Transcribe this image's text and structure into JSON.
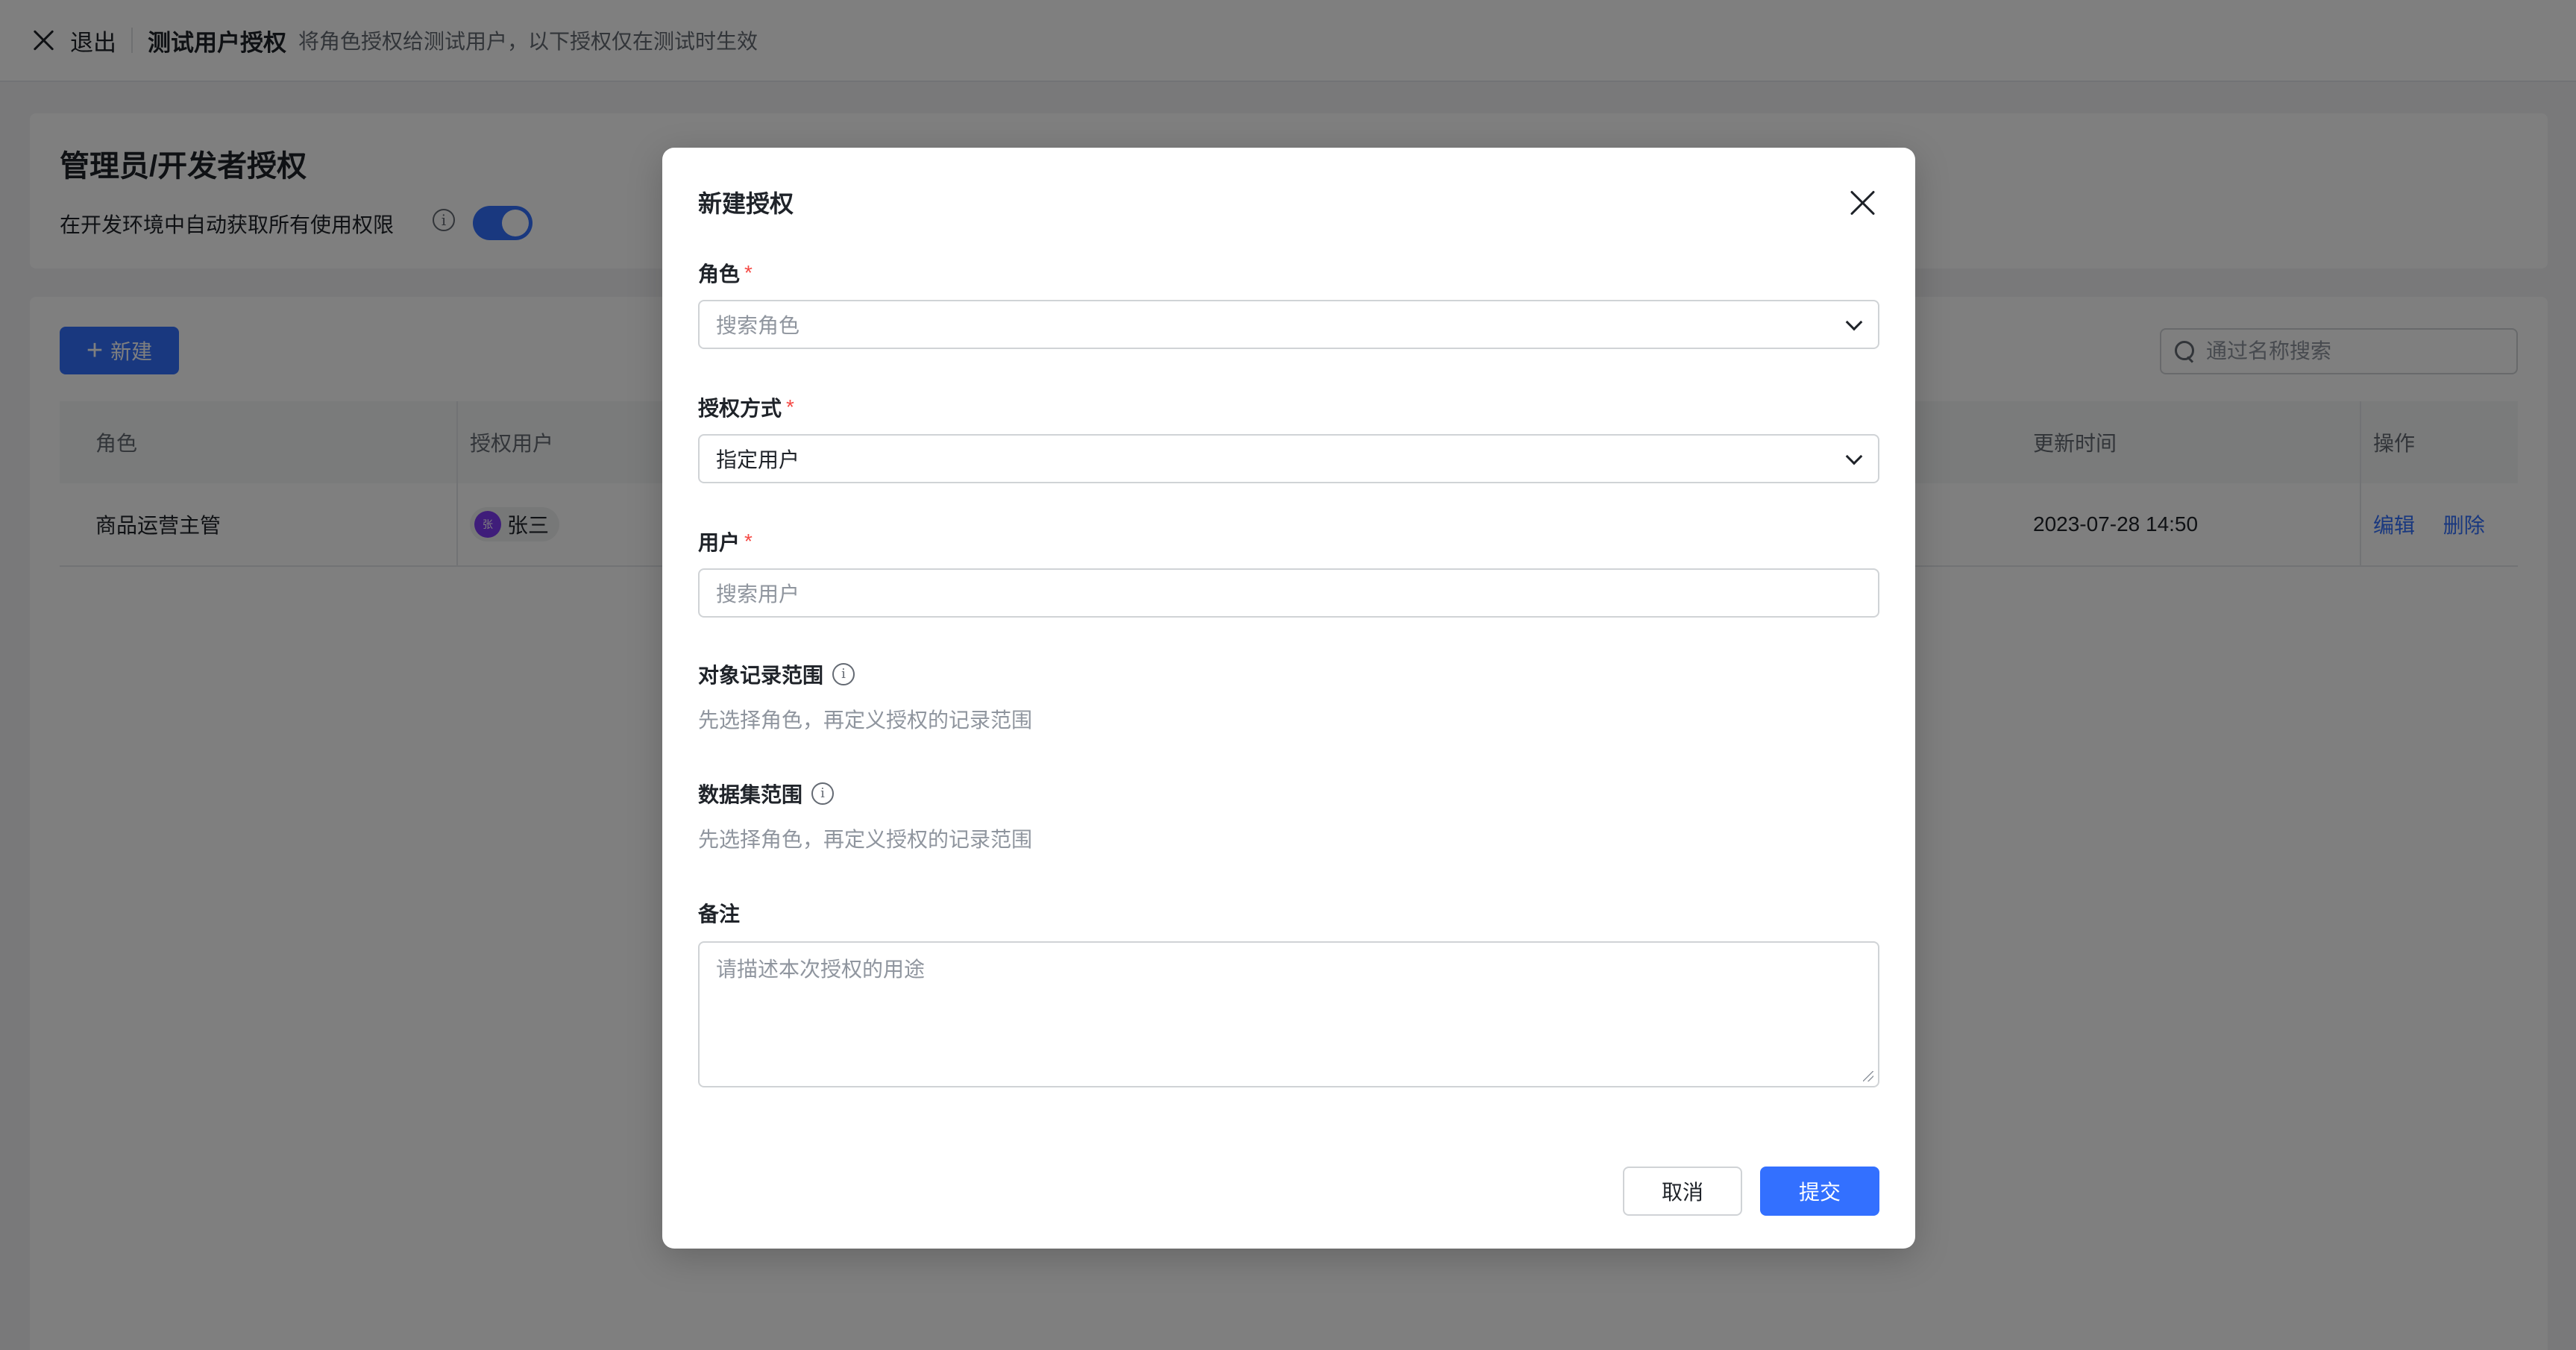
{
  "topbar": {
    "exit_label": "退出",
    "title": "测试用户授权",
    "subtitle": "将角色授权给测试用户，以下授权仅在测试时生效"
  },
  "admin_card": {
    "heading": "管理员/开发者授权",
    "auto_permission_label": "在开发环境中自动获取所有使用权限",
    "info_icon": "info-circle-icon",
    "toggle_on": true
  },
  "list": {
    "new_button_label": "新建",
    "search_placeholder": "通过名称搜索",
    "columns": [
      "角色",
      "授权用户",
      "更新时间",
      "操作"
    ],
    "rows": [
      {
        "role": "商品运营主管",
        "user_avatar": "张",
        "user_name": "张三",
        "updated": "2023-07-28 14:50",
        "actions": [
          "编辑",
          "删除"
        ]
      }
    ]
  },
  "modal": {
    "title": "新建授权",
    "role": {
      "label": "角色",
      "placeholder": "搜索角色"
    },
    "auth_method": {
      "label": "授权方式",
      "value": "指定用户"
    },
    "user": {
      "label": "用户",
      "placeholder": "搜索用户"
    },
    "record_scope": {
      "label": "对象记录范围",
      "hint": "先选择角色，再定义授权的记录范围"
    },
    "dataset_scope": {
      "label": "数据集范围",
      "hint": "先选择角色，再定义授权的记录范围"
    },
    "remark": {
      "label": "备注",
      "placeholder": "请描述本次授权的用途"
    },
    "cancel_label": "取消",
    "submit_label": "提交",
    "required_mark": "*"
  },
  "colors": {
    "primary": "#3370ff",
    "required": "#f54a45",
    "avatar": "#7f3bf5"
  }
}
